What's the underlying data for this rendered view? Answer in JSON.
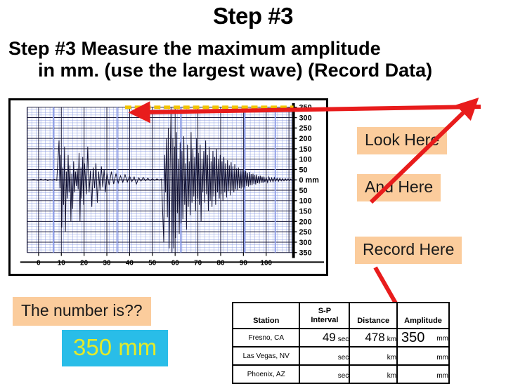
{
  "slide": {
    "title": "Step #3",
    "body_line_1": "Step #3   Measure the maximum amplitude",
    "body_line_2": "in mm. (use the largest wave) (Record Data)"
  },
  "callouts": {
    "look_here": "Look Here",
    "and_here": "And Here",
    "record_here": "Record Here",
    "question": "The number is??",
    "answer": "350 mm"
  },
  "colors": {
    "callout_bg": "#fbcc9c",
    "answer_bg": "#29bde8",
    "answer_text": "#e3ea2a",
    "arrow": "#e81c1c",
    "highlight_dash": "#f2c400",
    "grid_minor": "#8e9ee0",
    "grid_major": "#1a1a3c",
    "trace": "#111133"
  },
  "chart_data": {
    "type": "line",
    "title": "",
    "xlabel": "",
    "ylabel": "0 mm",
    "xlim": [
      -5,
      112
    ],
    "ylim": [
      -350,
      350
    ],
    "grid": true,
    "legend": null,
    "x_ticks": [
      0,
      10,
      20,
      30,
      40,
      50,
      60,
      70,
      80,
      90,
      100
    ],
    "x_tick_labels": [
      "0",
      "10",
      "20",
      "30",
      "40",
      "50",
      "60",
      "70",
      "80",
      "90",
      "100"
    ],
    "y_ticks": [
      350,
      300,
      250,
      200,
      150,
      100,
      50,
      0,
      -50,
      -100,
      -150,
      -200,
      -250,
      -300,
      -350
    ],
    "y_tick_labels": [
      "350",
      "300",
      "250",
      "200",
      "150",
      "100",
      "50",
      "0 mm",
      "50",
      "100",
      "150",
      "200",
      "250",
      "300",
      "350"
    ],
    "annotations": [
      {
        "kind": "dashed-horizontal-line",
        "y": 350,
        "x_start": 38,
        "x_end": 112,
        "color": "#f2c400",
        "label": "max amplitude level"
      }
    ],
    "max_amplitude_mm": 350,
    "series": [
      {
        "name": "Seismogram trace",
        "points": [
          [
            -4,
            0
          ],
          [
            -2,
            2
          ],
          [
            0,
            -3
          ],
          [
            1,
            4
          ],
          [
            2,
            -2
          ],
          [
            3,
            3
          ],
          [
            4,
            -4
          ],
          [
            5,
            2
          ],
          [
            6,
            -2
          ],
          [
            7,
            3
          ],
          [
            8,
            -3
          ],
          [
            9,
            190
          ],
          [
            9.4,
            -40
          ],
          [
            9.8,
            120
          ],
          [
            10.2,
            -230
          ],
          [
            10.6,
            60
          ],
          [
            11,
            -120
          ],
          [
            11.4,
            160
          ],
          [
            11.8,
            -250
          ],
          [
            12.2,
            40
          ],
          [
            12.6,
            -90
          ],
          [
            13,
            120
          ],
          [
            13.4,
            -60
          ],
          [
            13.8,
            70
          ],
          [
            14.2,
            -200
          ],
          [
            14.6,
            30
          ],
          [
            15,
            -140
          ],
          [
            15.4,
            90
          ],
          [
            15.8,
            -60
          ],
          [
            16.2,
            40
          ],
          [
            16.6,
            -30
          ],
          [
            17,
            55
          ],
          [
            17.4,
            -45
          ],
          [
            17.8,
            130
          ],
          [
            18.2,
            -200
          ],
          [
            18.6,
            60
          ],
          [
            19,
            -90
          ],
          [
            19.4,
            110
          ],
          [
            19.8,
            -120
          ],
          [
            20.2,
            80
          ],
          [
            21,
            -70
          ],
          [
            21.6,
            160
          ],
          [
            22.2,
            -60
          ],
          [
            22.8,
            45
          ],
          [
            23.4,
            -130
          ],
          [
            24,
            60
          ],
          [
            24.6,
            -40
          ],
          [
            25.2,
            80
          ],
          [
            25.8,
            -110
          ],
          [
            26.4,
            40
          ],
          [
            27,
            -50
          ],
          [
            27.6,
            65
          ],
          [
            28.2,
            -35
          ],
          [
            28.8,
            50
          ],
          [
            29.4,
            -60
          ],
          [
            30,
            35
          ],
          [
            31,
            -25
          ],
          [
            32,
            40
          ],
          [
            33,
            -20
          ],
          [
            34,
            30
          ],
          [
            35,
            -15
          ],
          [
            36,
            20
          ],
          [
            37,
            -12
          ],
          [
            38,
            25
          ],
          [
            39,
            -10
          ],
          [
            40,
            18
          ],
          [
            41,
            -8
          ],
          [
            42,
            14
          ],
          [
            43,
            -20
          ],
          [
            44,
            10
          ],
          [
            45,
            -6
          ],
          [
            46,
            12
          ],
          [
            47,
            -5
          ],
          [
            48,
            8
          ],
          [
            49,
            -4
          ],
          [
            50,
            6
          ],
          [
            51,
            -3
          ],
          [
            52,
            5
          ],
          [
            53,
            -2
          ],
          [
            54,
            4
          ],
          [
            55,
            -300
          ],
          [
            55.4,
            120
          ],
          [
            55.8,
            -60
          ],
          [
            56.2,
            200
          ],
          [
            56.6,
            -180
          ],
          [
            57,
            250
          ],
          [
            57.4,
            -330
          ],
          [
            57.8,
            60
          ],
          [
            58.2,
            350
          ],
          [
            58.6,
            -350
          ],
          [
            59,
            200
          ],
          [
            59.4,
            -330
          ],
          [
            59.8,
            160
          ],
          [
            60.2,
            -280
          ],
          [
            60.6,
            230
          ],
          [
            61,
            -160
          ],
          [
            61.4,
            100
          ],
          [
            61.8,
            -260
          ],
          [
            62.2,
            180
          ],
          [
            62.6,
            -210
          ],
          [
            63,
            140
          ],
          [
            63.4,
            -190
          ],
          [
            63.8,
            210
          ],
          [
            64.2,
            -120
          ],
          [
            64.6,
            80
          ],
          [
            65,
            -240
          ],
          [
            65.4,
            170
          ],
          [
            65.8,
            -130
          ],
          [
            66.2,
            90
          ],
          [
            66.6,
            -170
          ],
          [
            67,
            230
          ],
          [
            67.4,
            -110
          ],
          [
            67.8,
            150
          ],
          [
            68.2,
            -80
          ],
          [
            68.6,
            110
          ],
          [
            69,
            -150
          ],
          [
            69.4,
            200
          ],
          [
            69.8,
            -90
          ],
          [
            70.2,
            130
          ],
          [
            70.6,
            -120
          ],
          [
            71,
            170
          ],
          [
            71.4,
            -200
          ],
          [
            71.8,
            100
          ],
          [
            72.2,
            -60
          ],
          [
            72.6,
            140
          ],
          [
            73,
            -110
          ],
          [
            73.4,
            190
          ],
          [
            73.8,
            -70
          ],
          [
            74.2,
            120
          ],
          [
            74.6,
            -150
          ],
          [
            75,
            160
          ],
          [
            75.4,
            -100
          ],
          [
            75.8,
            90
          ],
          [
            76.2,
            -130
          ],
          [
            76.6,
            140
          ],
          [
            77,
            -80
          ],
          [
            77.4,
            110
          ],
          [
            77.8,
            -120
          ],
          [
            78.2,
            150
          ],
          [
            78.6,
            -60
          ],
          [
            79,
            100
          ],
          [
            79.4,
            -90
          ],
          [
            79.8,
            120
          ],
          [
            80.2,
            -70
          ],
          [
            80.6,
            90
          ],
          [
            81,
            -100
          ],
          [
            81.4,
            110
          ],
          [
            81.8,
            -60
          ],
          [
            82.2,
            80
          ],
          [
            82.6,
            -85
          ],
          [
            83,
            95
          ],
          [
            83.4,
            -55
          ],
          [
            83.8,
            70
          ],
          [
            84.2,
            -75
          ],
          [
            84.6,
            85
          ],
          [
            85,
            -50
          ],
          [
            85.4,
            65
          ],
          [
            85.8,
            -60
          ],
          [
            86.2,
            75
          ],
          [
            86.6,
            -45
          ],
          [
            87,
            55
          ],
          [
            87.4,
            -50
          ],
          [
            87.8,
            60
          ],
          [
            88.2,
            -40
          ],
          [
            88.6,
            48
          ],
          [
            89,
            -42
          ],
          [
            89.4,
            52
          ],
          [
            89.8,
            -35
          ],
          [
            90.2,
            40
          ],
          [
            90.6,
            -38
          ],
          [
            91,
            44
          ],
          [
            91.4,
            -30
          ],
          [
            91.8,
            34
          ],
          [
            92.2,
            -32
          ],
          [
            92.6,
            38
          ],
          [
            93,
            -26
          ],
          [
            93.4,
            28
          ],
          [
            93.8,
            -26
          ],
          [
            94.2,
            30
          ],
          [
            94.6,
            -20
          ],
          [
            95,
            24
          ],
          [
            95.4,
            -22
          ],
          [
            95.8,
            26
          ],
          [
            96.2,
            -16
          ],
          [
            96.6,
            18
          ],
          [
            97,
            -18
          ],
          [
            97.4,
            20
          ],
          [
            97.8,
            -14
          ],
          [
            98.2,
            16
          ],
          [
            98.6,
            -14
          ],
          [
            99,
            16
          ],
          [
            99.4,
            -10
          ],
          [
            100,
            12
          ],
          [
            100.6,
            -12
          ],
          [
            101.2,
            14
          ],
          [
            101.8,
            -8
          ],
          [
            102.4,
            10
          ],
          [
            103,
            -9
          ],
          [
            103.6,
            11
          ],
          [
            104.2,
            -6
          ],
          [
            104.8,
            8
          ],
          [
            105.4,
            -7
          ],
          [
            106,
            8
          ],
          [
            106.6,
            -5
          ],
          [
            107.2,
            6
          ],
          [
            107.8,
            -5
          ],
          [
            108.4,
            6
          ],
          [
            109,
            -4
          ],
          [
            109.6,
            5
          ],
          [
            110.2,
            -4
          ],
          [
            110.8,
            4
          ],
          [
            111.4,
            -3
          ],
          [
            112,
            3
          ]
        ]
      }
    ]
  },
  "table": {
    "columns": [
      "Station",
      "S-P Interval",
      "Distance",
      "Amplitude"
    ],
    "column_line_breaks": {
      "S-P Interval": [
        "S-P",
        "Interval"
      ]
    },
    "units": {
      "s_p_interval": "sec",
      "distance": "km",
      "amplitude": "mm"
    },
    "rows": [
      {
        "station": "Fresno, CA",
        "sp_interval": "49",
        "sp_unit": "sec",
        "distance": "478",
        "distance_unit": "km",
        "amplitude": "350",
        "amplitude_unit": "mm"
      },
      {
        "station": "Las Vegas, NV",
        "sp_interval": "",
        "sp_unit": "sec",
        "distance": "",
        "distance_unit": "km",
        "amplitude": "",
        "amplitude_unit": "mm"
      },
      {
        "station": "Phoenix, AZ",
        "sp_interval": "",
        "sp_unit": "sec",
        "distance": "",
        "distance_unit": "km",
        "amplitude": "",
        "amplitude_unit": "mm"
      }
    ]
  }
}
